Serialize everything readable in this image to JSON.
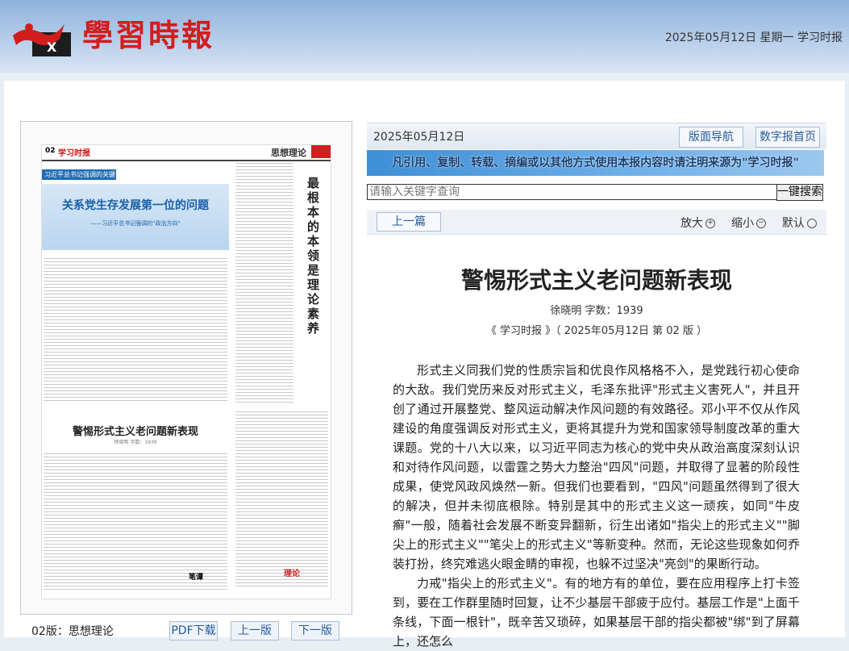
{
  "colors": {
    "brand_red": "#d21d1d",
    "accent_blue": "#2a5b9a"
  },
  "header": {
    "logo_text": "學習時報",
    "date_info": "2025年05月12日 星期一 学习时报"
  },
  "paper_preview": {
    "page_num": "02",
    "logo_text": "学习时报",
    "section": "思想理论",
    "tag": "习近平总书记强调的关键词",
    "banner_title": "关系党生存发展第一位的问题",
    "banner_subtitle": "——习近平总书记强调的\"政治方向\"",
    "vertical_title": "最根本的本领是理论素养",
    "sub_title": "警惕形式主义老问题新表现",
    "col_label": "笔谭",
    "col_logo": "理论"
  },
  "page_bar": {
    "label": "02版：思想理论",
    "pdf_button": "PDF下载",
    "prev_button": "上一版",
    "next_button": "下一版"
  },
  "nav": {
    "date": "2025年05月12日",
    "layout_nav": "版面导航",
    "digital_home": "数字报首页"
  },
  "notice": "凡引用、复制、转载、摘编或以其他方式使用本报内容时请注明来源为\"学习时报\"",
  "search": {
    "placeholder": "请输入关键字查询",
    "button": "一键搜索"
  },
  "toolbar": {
    "prev": "上一篇",
    "zoom_in": "放大",
    "zoom_out": "缩小",
    "default": "默认"
  },
  "article": {
    "title": "警惕形式主义老问题新表现",
    "meta": "徐晓明 字数：1939",
    "source": "《 学习时报 》（ 2025年05月12日 第 02 版 ）",
    "paragraphs": [
      "形式主义同我们党的性质宗旨和优良作风格格不入，是党践行初心使命的大敌。我们党历来反对形式主义，毛泽东批评\"形式主义害死人\"，并且开创了通过开展整党、整风运动解决作风问题的有效路径。邓小平不仅从作风建设的角度强调反对形式主义，更将其提升为党和国家领导制度改革的重大课题。党的十八大以来，以习近平同志为核心的党中央从政治高度深刻认识和对待作风问题，以雷霆之势大力整治\"四风\"问题，并取得了显著的阶段性成果，使党风政风焕然一新。但我们也要看到，\"四风\"问题虽然得到了很大的解决，但并未彻底根除。特别是其中的形式主义这一顽疾，如同\"牛皮癣\"一般，随着社会发展不断变异翻新，衍生出诸如\"指尖上的形式主义\"\"脚尖上的形式主义\"\"笔尖上的形式主义\"等新变种。然而，无论这些现象如何乔装打扮，终究难逃火眼金睛的审视，也躲不过坚决\"亮剑\"的果断行动。",
      "力戒\"指尖上的形式主义\"。有的地方有的单位，要在应用程序上打卡签到，要在工作群里随时回复，让不少基层干部疲于应付。基层工作是\"上面千条线，下面一根针\"，既辛苦又琐碎，如果基层干部的指尖都被\"绑\"到了屏幕上，还怎么"
    ]
  }
}
